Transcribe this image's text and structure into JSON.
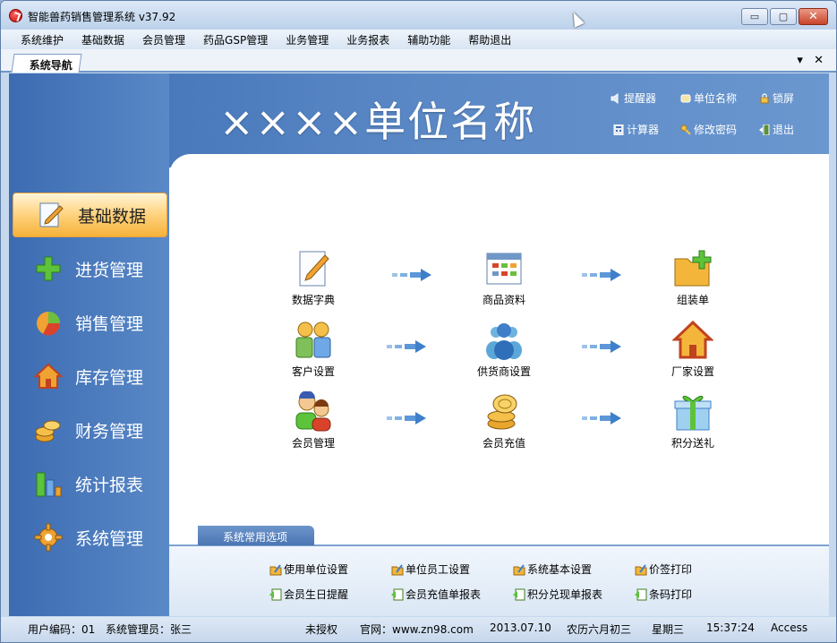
{
  "window": {
    "title": "智能兽药销售管理系统 v37.92",
    "controls": {
      "minimize": "▭",
      "maximize": "▢",
      "close": "✕"
    }
  },
  "menu": [
    "系统维护",
    "基础数据",
    "会员管理",
    "药品GSP管理",
    "业务管理",
    "业务报表",
    "辅助功能",
    "帮助退出"
  ],
  "tab": {
    "label": "系统导航",
    "dropdown": "▾",
    "close": "✕"
  },
  "banner": {
    "title": "××××单位名称"
  },
  "quick_actions": {
    "reminder": "提醒器",
    "unit_name": "单位名称",
    "lock": "锁屏",
    "calculator": "计算器",
    "change_password": "修改密码",
    "exit": "退出"
  },
  "sidebar": [
    {
      "label": "基础数据",
      "icon": "pencil-doc-icon",
      "active": true
    },
    {
      "label": "进货管理",
      "icon": "plus-icon",
      "active": false
    },
    {
      "label": "销售管理",
      "icon": "pie-chart-icon",
      "active": false
    },
    {
      "label": "库存管理",
      "icon": "house-icon",
      "active": false
    },
    {
      "label": "财务管理",
      "icon": "coins-icon",
      "active": false
    },
    {
      "label": "统计报表",
      "icon": "bar-chart-icon",
      "active": false
    },
    {
      "label": "系统管理",
      "icon": "gear-icon",
      "active": false
    }
  ],
  "modules": {
    "data_dictionary": "数据字典",
    "product_info": "商品资料",
    "assembly": "组装单",
    "customer_settings": "客户设置",
    "supplier_settings": "供货商设置",
    "manufacturer_settings": "厂家设置",
    "member_management": "会员管理",
    "member_recharge": "会员充值",
    "points_gift": "积分送礼"
  },
  "common": {
    "tab_label": "系统常用选项",
    "links": {
      "unit_settings": "使用单位设置",
      "employee_settings": "单位员工设置",
      "system_settings": "系统基本设置",
      "price_tag_print": "价签打印",
      "birthday_reminder": "会员生日提醒",
      "recharge_report": "会员充值单报表",
      "points_report": "积分兑现单报表",
      "barcode_print": "条码打印"
    }
  },
  "status": {
    "user_code": "用户编码：01",
    "operator": "系统管理员：张三",
    "license": "未授权",
    "website": "官网：www.zn98.com",
    "date": "2013.07.10",
    "lunar": "农历六月初三",
    "weekday": "星期三",
    "time": "15:37:24",
    "db": "Access"
  }
}
